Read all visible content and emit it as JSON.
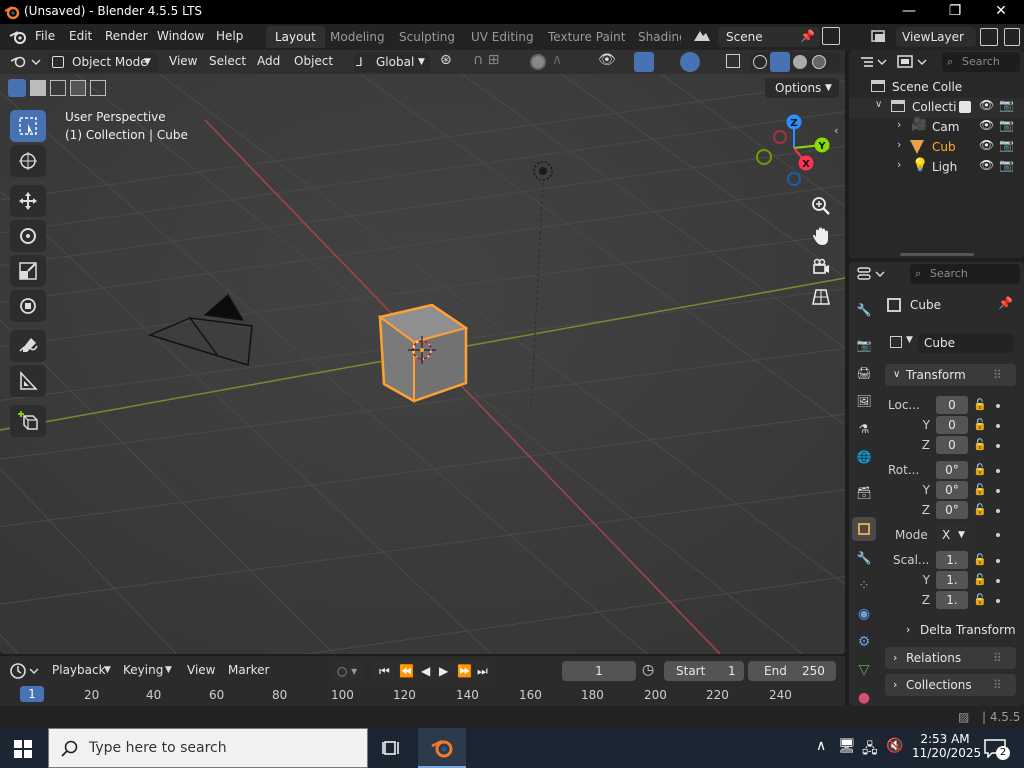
{
  "window": {
    "title": "(Unsaved) - Blender 4.5.5 LTS"
  },
  "menubar": {
    "items": [
      "File",
      "Edit",
      "Render",
      "Window",
      "Help"
    ]
  },
  "workspaces": {
    "tabs": [
      "Layout",
      "Modeling",
      "Sculpting",
      "UV Editing",
      "Texture Paint",
      "Shading"
    ],
    "active": "Layout"
  },
  "scene": {
    "name": "Scene"
  },
  "viewlayer": {
    "name": "ViewLayer"
  },
  "viewport_header": {
    "mode": "Object Mode",
    "menus": [
      "View",
      "Select",
      "Add",
      "Object"
    ],
    "orientation": "Global",
    "options": "Options"
  },
  "viewport": {
    "perspective": "User Perspective",
    "context": "(1) Collection | Cube",
    "gizmo": {
      "x": "X",
      "y": "Y",
      "z": "Z"
    }
  },
  "outliner": {
    "search_placeholder": "Search",
    "scene_collection": "Scene Colle",
    "collection": "Collecti",
    "objects": [
      "Cam",
      "Cub",
      "Ligh"
    ]
  },
  "properties": {
    "search_placeholder": "Search",
    "object_name": "Cube",
    "data_name": "Cube",
    "transform_label": "Transform",
    "location": {
      "label": "Loc...",
      "x": "0",
      "y": "0",
      "z": "0"
    },
    "rotation": {
      "label": "Rot...",
      "x": "0°",
      "y": "0°",
      "z": "0°"
    },
    "mode": {
      "label": "Mode",
      "value": "X"
    },
    "scale": {
      "label": "Scal...",
      "x": "1.",
      "y": "1.",
      "z": "1."
    },
    "axis_labels": {
      "y": "Y",
      "z": "Z"
    },
    "delta_transform": "Delta Transform",
    "relations": "Relations",
    "collections": "Collections"
  },
  "timeline": {
    "menus": [
      "Playback",
      "Keying",
      "View",
      "Marker"
    ],
    "current_frame": "1",
    "start_label": "Start",
    "start": "1",
    "end_label": "End",
    "end": "250",
    "ticks": [
      "1",
      "20",
      "40",
      "60",
      "80",
      "100",
      "120",
      "140",
      "160",
      "180",
      "200",
      "220",
      "240"
    ]
  },
  "statusbar": {
    "version": "4.5.5"
  },
  "taskbar": {
    "search_placeholder": "Type here to search",
    "time": "2:53 AM",
    "date": "11/20/2025",
    "notifications": "2"
  },
  "colors": {
    "accent": "#4772b3",
    "selection": "#ffa033",
    "x_axis": "#ff3352",
    "y_axis": "#8bdc00",
    "z_axis": "#2890ff"
  }
}
